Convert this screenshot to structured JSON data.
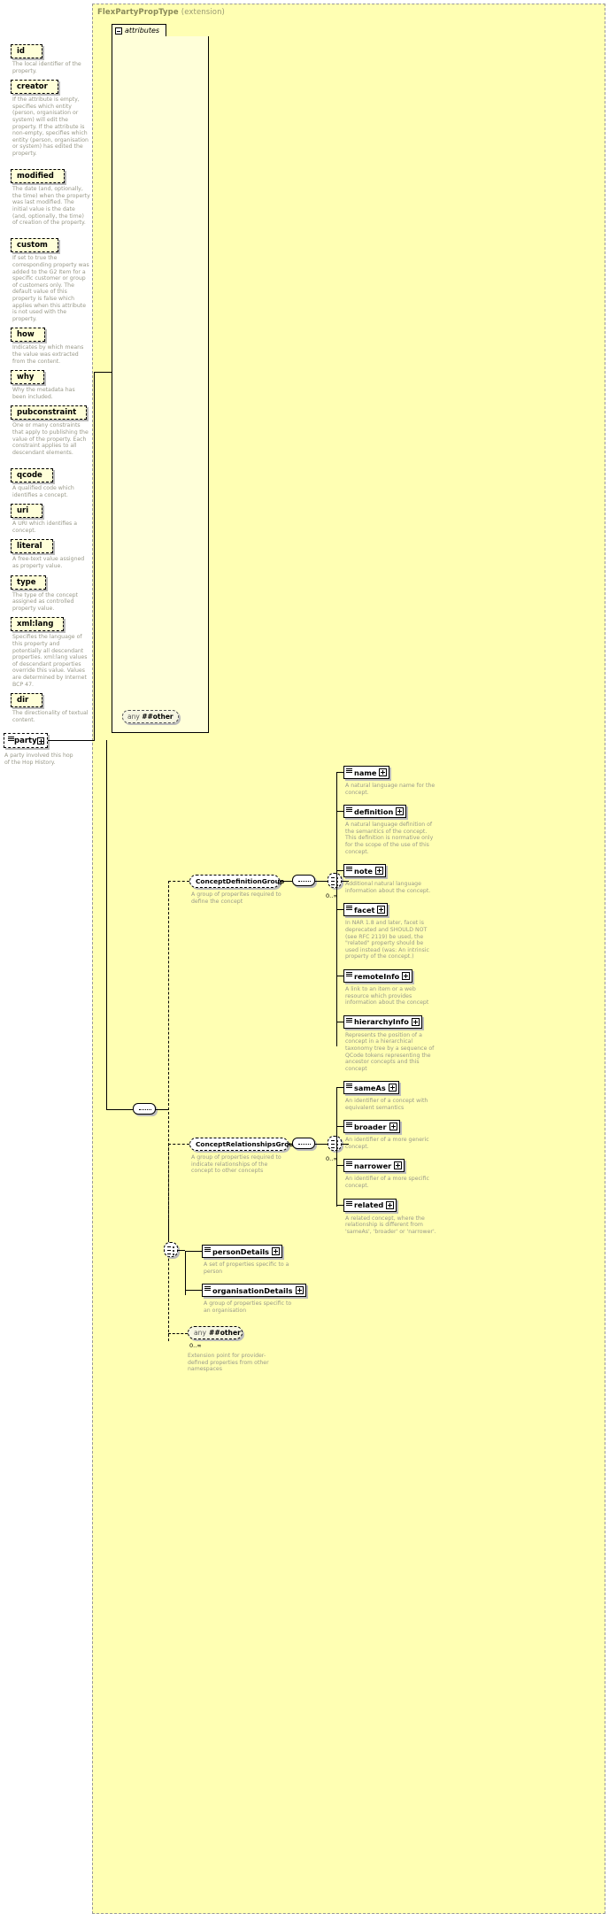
{
  "diagram": {
    "type": "xsd-schema-diagram",
    "extension_title": "FlexPartyPropType",
    "extension_suffix": "(extension)",
    "attributes_label": "attributes",
    "any_other_label": "any",
    "any_other_ns": "##other"
  },
  "root": {
    "name": "party",
    "description": "A party involved this hop of the Hop History."
  },
  "attributes": [
    {
      "name": "id",
      "description": "The local identifier of the property."
    },
    {
      "name": "creator",
      "description": "If the attribute is empty, specifies which entity (person, organisation or system) will edit the property. If the attribute is non-empty, specifies which entity (person, organisation or system) has edited the property."
    },
    {
      "name": "modified",
      "description": "The date (and, optionally, the time) when the property was last modified. The initial value is the date (and, optionally, the time) of creation of the property."
    },
    {
      "name": "custom",
      "description": "If set to true the corresponding property was added to the G2 Item for a specific customer or group of customers only. The default value of this property is false which applies when this attribute is not used with the property."
    },
    {
      "name": "how",
      "description": "Indicates by which means the value was extracted from the content."
    },
    {
      "name": "why",
      "description": "Why the metadata has been included."
    },
    {
      "name": "pubconstraint",
      "description": "One or many constraints that apply to publishing the value of the property. Each constraint applies to all descendant elements."
    },
    {
      "name": "qcode",
      "description": "A qualified code which identifies a concept."
    },
    {
      "name": "uri",
      "description": "A URI which identifies a concept."
    },
    {
      "name": "literal",
      "description": "A free-text value assigned as property value."
    },
    {
      "name": "type",
      "description": "The type of the concept assigned as controlled property value."
    },
    {
      "name": "xml:lang",
      "description": "Specifies the language of this property and potentially all descendant properties. xml:lang values of descendant properties override this value. Values are determined by Internet BCP 47."
    },
    {
      "name": "dir",
      "description": "The directionality of textual content."
    }
  ],
  "groups": [
    {
      "name": "ConceptDefinitionGroup",
      "description": "A group of properites required to define the concept",
      "occurs": "0..∞",
      "members": [
        {
          "name": "name",
          "description": "A natural language name for the concept."
        },
        {
          "name": "definition",
          "description": "A natural language definition of the semantics of the concept. This definition is normative only for the scope of the use of this concept."
        },
        {
          "name": "note",
          "description": "Additional natural language information about the concept."
        },
        {
          "name": "facet",
          "description": "In NAR 1.8 and later, facet is deprecated and SHOULD NOT (see RFC 2119) be used, the \"related\" property should be used instead (was: An intrinsic property of the concept.)"
        },
        {
          "name": "remoteInfo",
          "description": "A link to an item or a web resource which provides information about the concept"
        },
        {
          "name": "hierarchyInfo",
          "description": "Represents the position of a concept in a hierarchical taxonomy tree by a sequence of QCode tokens representing the ancestor concepts and this concept"
        }
      ]
    },
    {
      "name": "ConceptRelationshipsGroup",
      "description": "A group of properties required to indicate relationships of the concept to other concepts",
      "occurs": "0..∞",
      "members": [
        {
          "name": "sameAs",
          "description": "An identifier of a concept with equivalent semantics"
        },
        {
          "name": "broader",
          "description": "An identifier of a more generic concept."
        },
        {
          "name": "narrower",
          "description": "An identifier of a more specific concept."
        },
        {
          "name": "related",
          "description": "A related concept, where the relationship is different from 'sameAs', 'broader' or 'narrower'."
        }
      ]
    }
  ],
  "details": [
    {
      "name": "personDetails",
      "description": "A set of properties specific to a person"
    },
    {
      "name": "organisationDetails",
      "description": "A group of properties specific to an organisation"
    }
  ],
  "extension_point": {
    "label": "any",
    "namespace": "##other",
    "occurs": "0..∞",
    "description": "Extension point for provider-defined properties from other namespaces"
  },
  "colors": {
    "panel_background": "#ffffb3",
    "attribute_background": "#ffffd9",
    "node_background": "#ffffff",
    "description_text": "#9a9a8a",
    "border": "#000000",
    "title_text": "#8a8a5a"
  }
}
